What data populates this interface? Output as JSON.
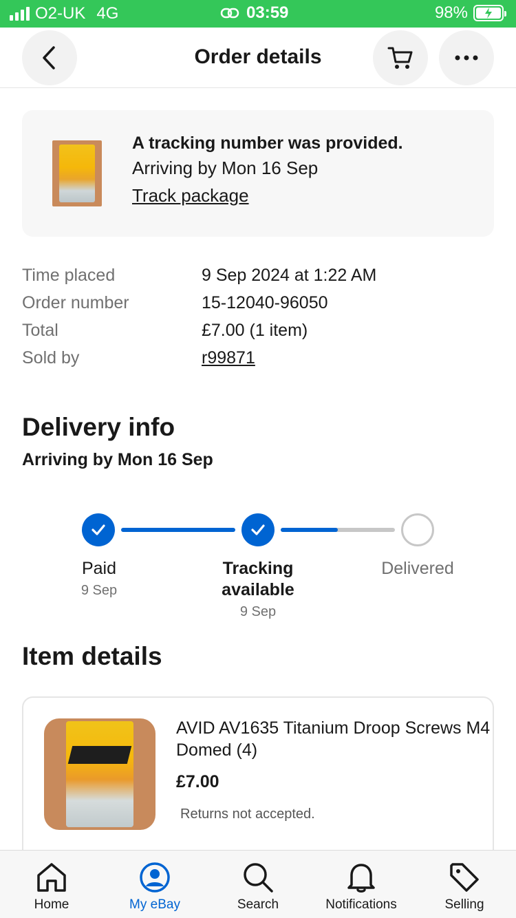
{
  "status_bar": {
    "carrier": "O2-UK",
    "network": "4G",
    "time": "03:59",
    "battery": "98%",
    "battery_level": 0.98
  },
  "header": {
    "title": "Order details",
    "back_icon": "chevron-left-icon",
    "cart_icon": "cart-icon",
    "more_icon": "more-icon"
  },
  "banner": {
    "headline": "A tracking number was provided.",
    "arrival": "Arriving by Mon 16 Sep",
    "track_link": "Track package"
  },
  "order": {
    "rows": [
      {
        "label": "Time placed",
        "value": "9 Sep 2024 at 1:22 AM"
      },
      {
        "label": "Order number",
        "value": "15-12040-96050"
      },
      {
        "label": "Total",
        "value": "£7.00 (1 item)"
      },
      {
        "label": "Sold by",
        "value": "r99871"
      }
    ]
  },
  "delivery": {
    "title": "Delivery info",
    "subtitle": "Arriving by Mon 16 Sep",
    "steps": [
      {
        "label": "Paid",
        "date": "9 Sep",
        "status": "done"
      },
      {
        "label": "Tracking available",
        "date": "9 Sep",
        "status": "done"
      },
      {
        "label": "Delivered",
        "date": "",
        "status": "pending"
      }
    ]
  },
  "items": {
    "title": "Item details",
    "item": {
      "name": "AVID AV1635 Titanium Droop Screws M4 Domed (4)",
      "price": "£7.00",
      "returns": "Returns not accepted."
    }
  },
  "tabbar": {
    "tabs": [
      {
        "label": "Home",
        "icon": "home-icon",
        "active": false
      },
      {
        "label": "My eBay",
        "icon": "account-icon",
        "active": true
      },
      {
        "label": "Search",
        "icon": "search-icon",
        "active": false
      },
      {
        "label": "Notifications",
        "icon": "bell-icon",
        "active": false
      },
      {
        "label": "Selling",
        "icon": "tag-icon",
        "active": false
      }
    ]
  },
  "colors": {
    "status_green": "#34c759",
    "ebay_blue": "#0064d2",
    "progress_gray": "#c7c7c7"
  }
}
